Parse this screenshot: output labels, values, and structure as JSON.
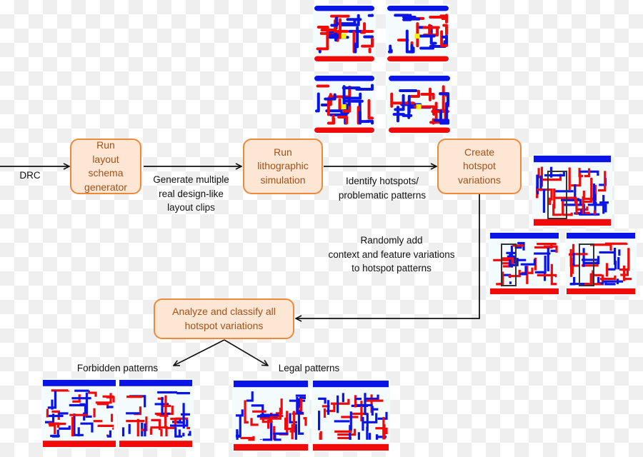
{
  "diagram": {
    "input_label": "DRC",
    "steps": [
      {
        "id": "layout-schema",
        "lines": [
          "Run",
          "layout",
          "schema",
          "generator"
        ]
      },
      {
        "id": "litho-sim",
        "lines": [
          "Run",
          "lithographic",
          "simulation"
        ]
      },
      {
        "id": "create-variations",
        "lines": [
          "Create",
          "hotspot",
          "variations"
        ]
      },
      {
        "id": "analyze-classify",
        "lines": [
          "Analyze and classify all",
          "hotspot variations"
        ]
      }
    ],
    "edge_labels": {
      "generate": [
        "Generate multiple",
        "real design-like",
        "layout clips"
      ],
      "identify": [
        "Identify hotspots/",
        "problematic patterns"
      ],
      "randomly": [
        "Randomly add",
        "context and feature variations",
        "to hotspot patterns"
      ]
    },
    "outputs": {
      "forbidden": "Forbidden patterns",
      "legal": "Legal patterns"
    },
    "colors": {
      "box_fill": "#fde6d4",
      "box_border": "#ea8a3a",
      "box_text": "#a0521a",
      "metal_blue": "#0a14e6",
      "metal_red": "#f00a0a",
      "hotspot_marker": "#f5f000",
      "hotspot_frame": "#333333"
    },
    "clip_groups": {
      "simulation_clips": 4,
      "hotspot_variation_clips": 3,
      "forbidden_clips": 2,
      "legal_clips": 2
    }
  }
}
